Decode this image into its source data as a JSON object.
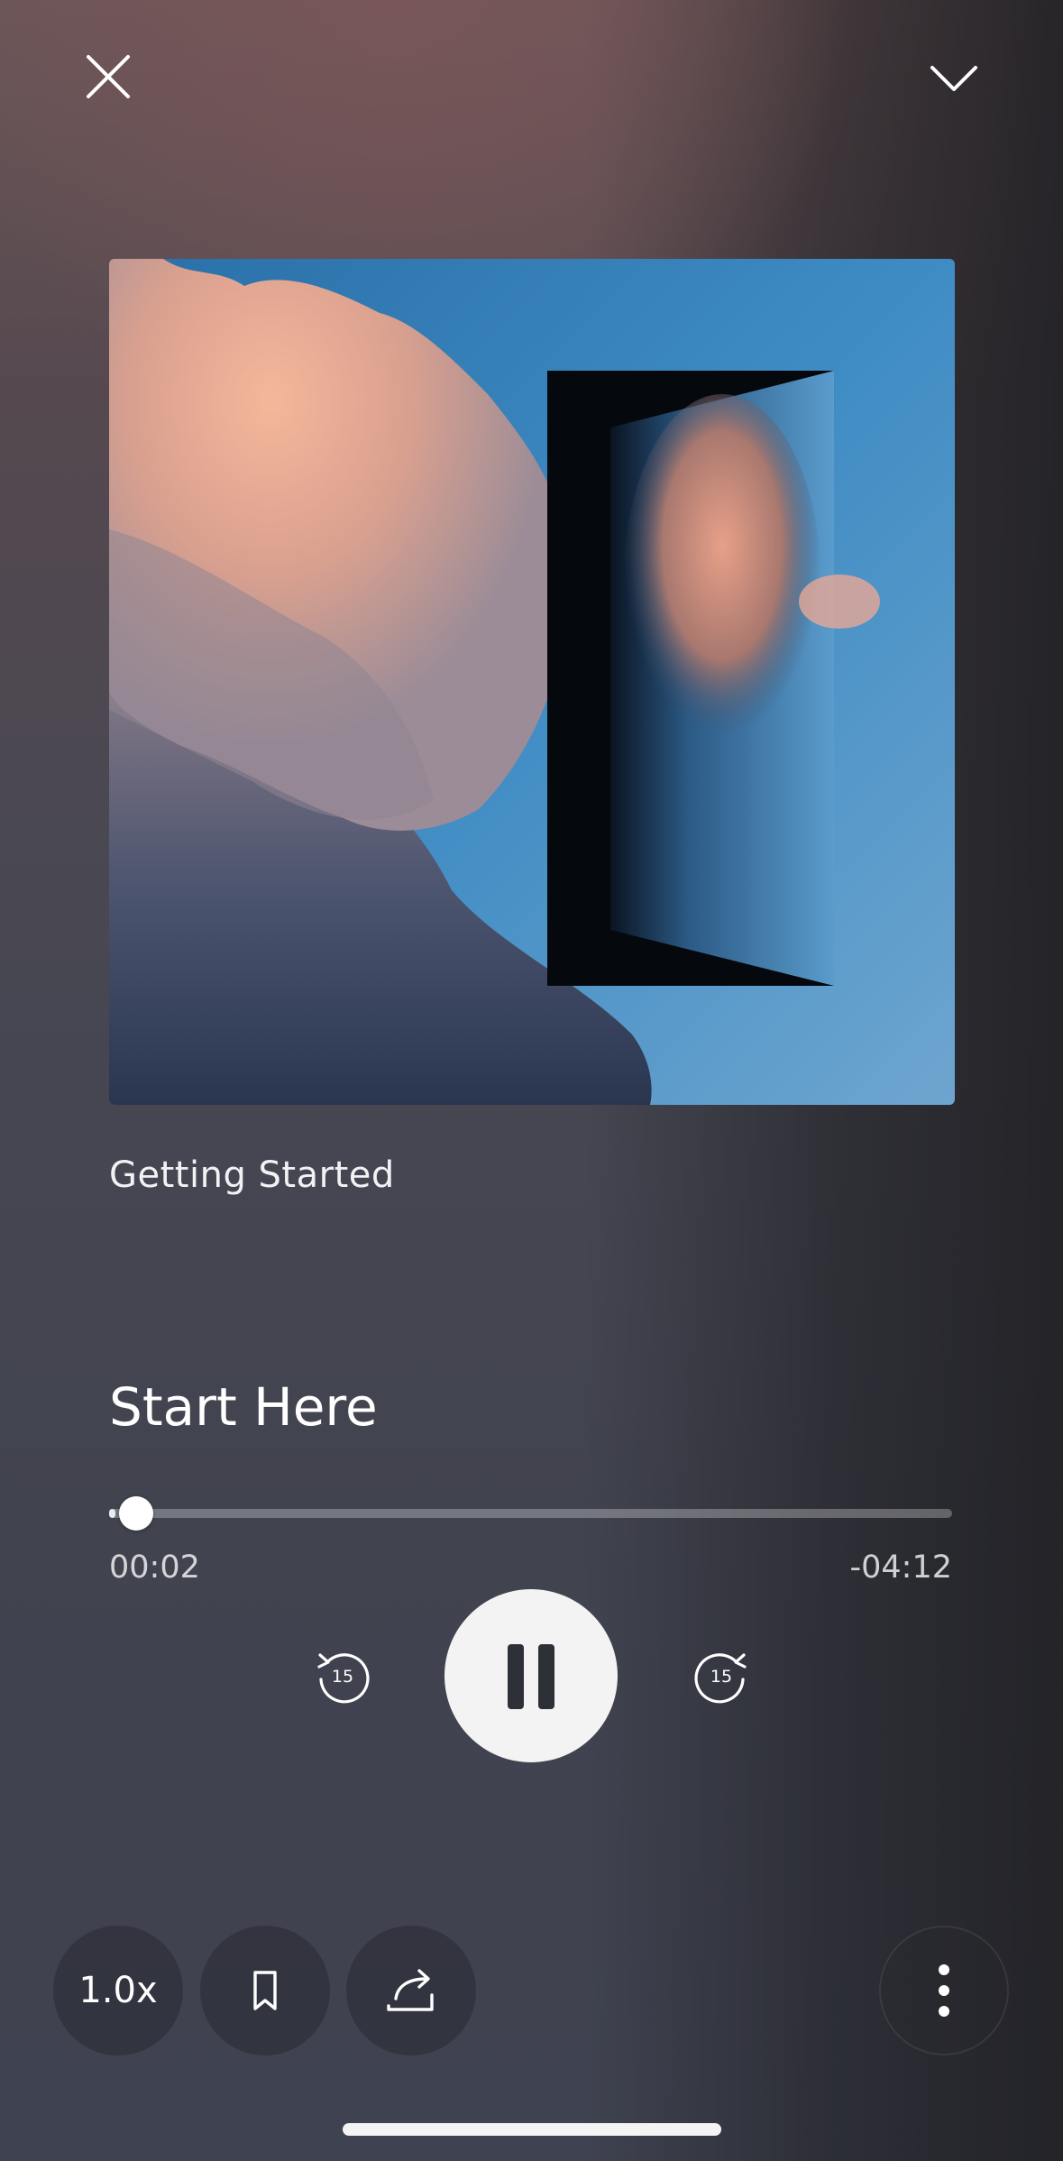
{
  "header": {
    "close_icon": "close-icon",
    "collapse_icon": "chevron-down-icon"
  },
  "artwork": {
    "description_icon": "album-artwork"
  },
  "now_playing": {
    "collection_title": "Getting Started",
    "track_title": "Start Here",
    "progress_fraction": 0.008,
    "time_elapsed": "00:02",
    "time_remaining": "-04:12"
  },
  "controls": {
    "skip_back_seconds": "15",
    "skip_forward_seconds": "15",
    "play_state": "playing"
  },
  "bottom_bar": {
    "speed_label": "1.0x",
    "bookmark_icon": "bookmark-icon",
    "share_icon": "share-icon",
    "more_icon": "more-vertical-icon"
  }
}
